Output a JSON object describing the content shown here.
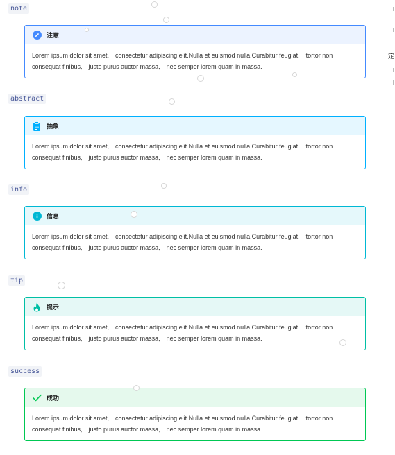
{
  "sections": [
    {
      "code": "note",
      "title": "注意",
      "icon": "pencil-icon",
      "color": "#448aff",
      "text": "Lorem ipsum dolor sit amet,　consectetur adipiscing elit.Nulla et euismod nulla.Curabitur feugiat,　tortor non consequat finibus,　justo purus auctor massa,　nec semper lorem quam in massa."
    },
    {
      "code": "abstract",
      "title": "抽象",
      "icon": "clipboard-icon",
      "color": "#00b0ff",
      "text": "Lorem ipsum dolor sit amet,　consectetur adipiscing elit.Nulla et euismod nulla.Curabitur feugiat,　tortor non consequat finibus,　justo purus auctor massa,　nec semper lorem quam in massa."
    },
    {
      "code": "info",
      "title": "信息",
      "icon": "info-icon",
      "color": "#00b8d4",
      "text": "Lorem ipsum dolor sit amet,　consectetur adipiscing elit.Nulla et euismod nulla.Curabitur feugiat,　tortor non consequat finibus,　justo purus auctor massa,　nec semper lorem quam in massa."
    },
    {
      "code": "tip",
      "title": "提示",
      "icon": "flame-icon",
      "color": "#00bfa5",
      "text": "Lorem ipsum dolor sit amet,　consectetur adipiscing elit.Nulla et euismod nulla.Curabitur feugiat,　tortor non consequat finibus,　justo purus auctor massa,　nec semper lorem quam in massa."
    },
    {
      "code": "success",
      "title": "成功",
      "icon": "check-icon",
      "color": "#00c853",
      "text": "Lorem ipsum dolor sit amet,　consectetur adipiscing elit.Nulla et euismod nulla.Curabitur feugiat,　tortor non consequat finibus,　justo purus auctor massa,　nec semper lorem quam in massa."
    }
  ],
  "edge_text": "定"
}
